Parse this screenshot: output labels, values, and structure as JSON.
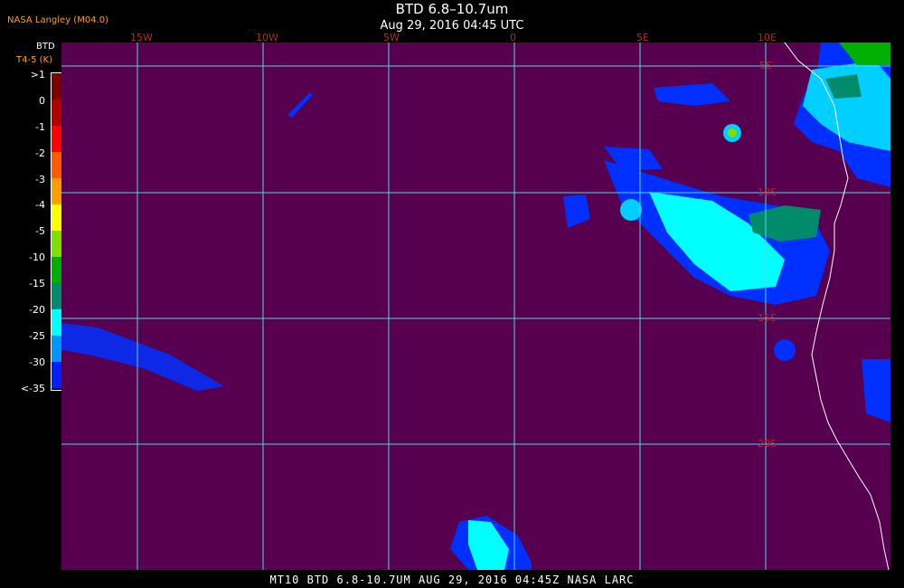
{
  "title": "BTD 6.8–10.7um",
  "subtitle": "Aug 29, 2016 04:45 UTC",
  "credit": "NASA Langley (M04.0)",
  "legend": {
    "name": "BTD",
    "units": "T4-5 (K)",
    "ticks": [
      ">1",
      "0",
      "-1",
      "-2",
      "-3",
      "-4",
      "-5",
      "-10",
      "-15",
      "-20",
      "-25",
      "-30",
      "<-35"
    ],
    "colors": [
      "#7a0000",
      "#b00000",
      "#ff0000",
      "#ff5a00",
      "#ff9e00",
      "#ffff00",
      "#7fe000",
      "#00b000",
      "#008c6a",
      "#00ffff",
      "#0096ff",
      "#0020ff",
      "#56004f"
    ]
  },
  "longitude_labels": [
    "15W",
    "10W",
    "5W",
    "0",
    "5E",
    "10E"
  ],
  "latitude_labels": [
    "5S",
    "10S",
    "15S",
    "20S"
  ],
  "footer": "MT10  BTD 6.8-10.7UM   AUG 29, 2016 04:45Z   NASA LARC",
  "colors": {
    "background": "#56004f",
    "grid": "#4fd6e6",
    "coast": "#ffffff"
  }
}
